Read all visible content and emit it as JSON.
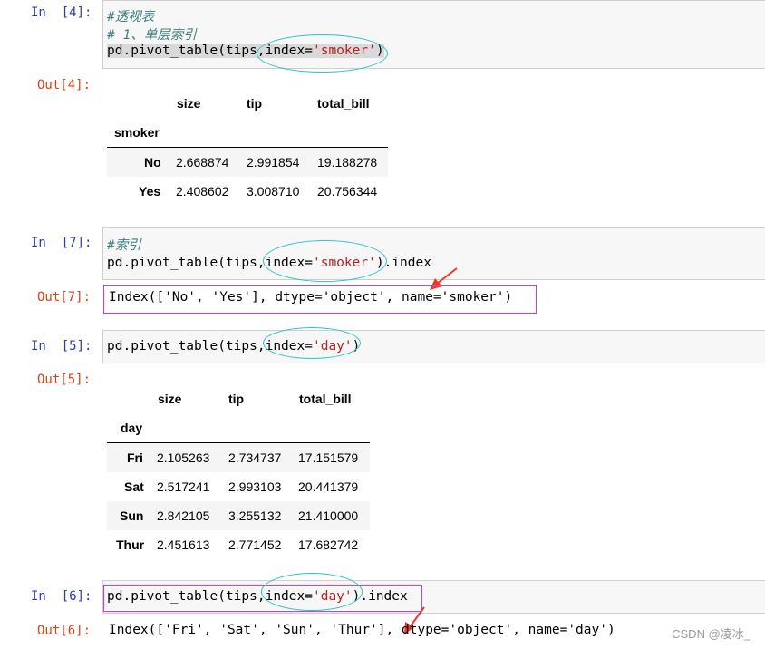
{
  "cells": [
    {
      "in_prompt": "In  [4]:",
      "code": [
        "#透视表",
        "# 1、单层索引",
        "pd.pivot_table(tips,index='smoker')"
      ],
      "code_parts": {
        "pre": "pd.pivot_table(tips,index=",
        "str": "'smoker'",
        "post": ")"
      },
      "out_prompt": "Out[4]:",
      "df": {
        "columns": [
          "size",
          "tip",
          "total_bill"
        ],
        "index_name": "smoker",
        "rows": [
          {
            "index": "No",
            "values": [
              "2.668874",
              "2.991854",
              "19.188278"
            ]
          },
          {
            "index": "Yes",
            "values": [
              "2.408602",
              "3.008710",
              "20.756344"
            ]
          }
        ]
      }
    },
    {
      "in_prompt": "In  [7]:",
      "comment": "#索引",
      "code_parts": {
        "pre": "pd.pivot_table(tips,index=",
        "str": "'smoker'",
        "post": ").index"
      },
      "out_prompt": "Out[7]:",
      "output": "Index(['No', 'Yes'], dtype='object', name='smoker')"
    },
    {
      "in_prompt": "In  [5]:",
      "code_parts": {
        "pre": "pd.pivot_table(tips,index=",
        "str": "'day'",
        "post": ")"
      },
      "out_prompt": "Out[5]:",
      "df": {
        "columns": [
          "size",
          "tip",
          "total_bill"
        ],
        "index_name": "day",
        "rows": [
          {
            "index": "Fri",
            "values": [
              "2.105263",
              "2.734737",
              "17.151579"
            ]
          },
          {
            "index": "Sat",
            "values": [
              "2.517241",
              "2.993103",
              "20.441379"
            ]
          },
          {
            "index": "Sun",
            "values": [
              "2.842105",
              "3.255132",
              "21.410000"
            ]
          },
          {
            "index": "Thur",
            "values": [
              "2.451613",
              "2.771452",
              "17.682742"
            ]
          }
        ]
      }
    },
    {
      "in_prompt": "In  [6]:",
      "code_parts": {
        "pre": "pd.pivot_table(tips,index=",
        "str": "'day'",
        "post": ").index"
      },
      "out_prompt": "Out[6]:",
      "output": "Index(['Fri', 'Sat', 'Sun', 'Thur'], dtype='object', name='day')"
    }
  ],
  "watermark": "CSDN @凌冰_",
  "colors": {
    "annotation_ellipse": "#2bc3c9",
    "annotation_box": "#d33cc9",
    "arrow": "#e8392b"
  }
}
